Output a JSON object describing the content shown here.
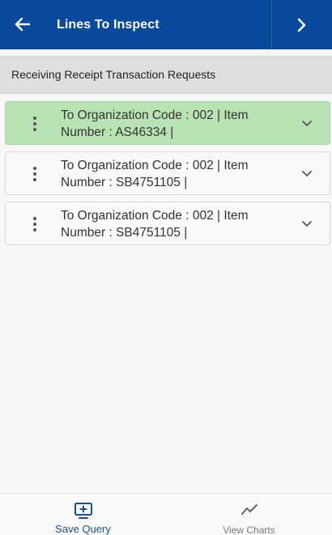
{
  "header": {
    "title": "Lines To Inspect",
    "back_icon": "arrow-left-icon",
    "next_icon": "chevron-right-icon",
    "background": "#0a4a9c"
  },
  "subheader": {
    "text": "Receiving Receipt Transaction Requests"
  },
  "list": {
    "items": [
      {
        "line1": "To Organization Code : 002 | Item",
        "line2": "Number : AS46334 |",
        "selected": true
      },
      {
        "line1": "To Organization Code : 002 | Item",
        "line2": "Number : SB4751105 |",
        "selected": false
      },
      {
        "line1": "To Organization Code : 002 | Item",
        "line2": "Number : SB4751105 |",
        "selected": false
      }
    ],
    "selected_color": "#b9e2b4"
  },
  "bottom_bar": {
    "save_label": "Save Query",
    "save_icon": "monitor-plus-icon",
    "charts_label": "View Charts",
    "charts_icon": "line-chart-icon"
  }
}
